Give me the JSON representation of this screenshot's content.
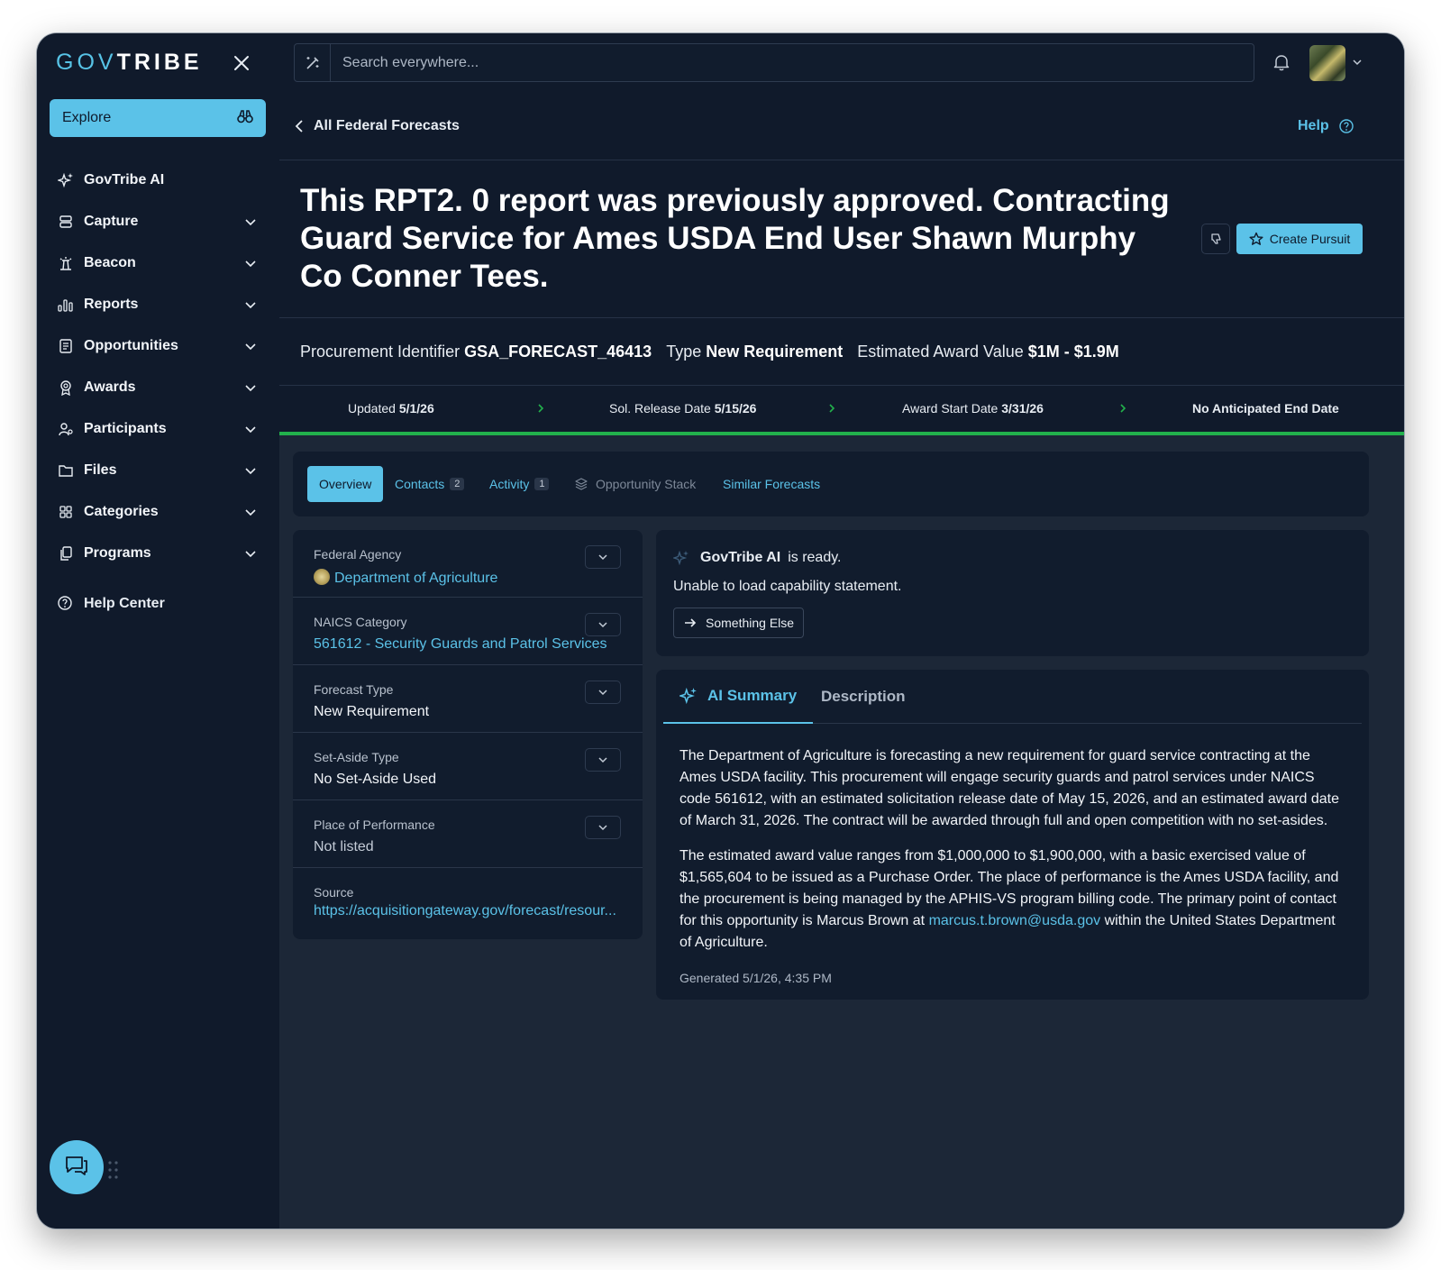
{
  "brand": {
    "gov": "GOV",
    "tribe": "TRIBE"
  },
  "sidebar": {
    "explore_label": "Explore",
    "items": [
      {
        "label": "GovTribe AI",
        "icon": "sparkle-icon",
        "expandable": false
      },
      {
        "label": "Capture",
        "icon": "stack-icon",
        "expandable": true
      },
      {
        "label": "Beacon",
        "icon": "beacon-icon",
        "expandable": true
      },
      {
        "label": "Reports",
        "icon": "bar-chart-icon",
        "expandable": true
      },
      {
        "label": "Opportunities",
        "icon": "document-icon",
        "expandable": true
      },
      {
        "label": "Awards",
        "icon": "award-icon",
        "expandable": true
      },
      {
        "label": "Participants",
        "icon": "people-icon",
        "expandable": true
      },
      {
        "label": "Files",
        "icon": "folder-icon",
        "expandable": true
      },
      {
        "label": "Categories",
        "icon": "grid-icon",
        "expandable": true
      },
      {
        "label": "Programs",
        "icon": "copy-icon",
        "expandable": true
      }
    ],
    "help_center": "Help Center"
  },
  "search": {
    "placeholder": "Search everywhere..."
  },
  "back_link": "All Federal Forecasts",
  "help_link": "Help",
  "page_title": "This RPT2. 0 report was previously approved. Contracting Guard Service for Ames USDA End User Shawn Murphy Co Conner Tees.",
  "create_pursuit": "Create Pursuit",
  "identifiers": {
    "procurement_label": "Procurement Identifier",
    "procurement_value": "GSA_FORECAST_46413",
    "type_label": "Type",
    "type_value": "New Requirement",
    "award_label": "Estimated Award Value",
    "award_value": "$1M - $1.9M"
  },
  "timeline": {
    "updated_label": "Updated",
    "updated_value": "5/1/26",
    "release_label": "Sol. Release Date",
    "release_value": "5/15/26",
    "start_label": "Award Start Date",
    "start_value": "3/31/26",
    "end_text": "No Anticipated End Date"
  },
  "tabs": {
    "overview": "Overview",
    "contacts": "Contacts",
    "contacts_count": "2",
    "activity": "Activity",
    "activity_count": "1",
    "stack": "Opportunity Stack",
    "similar": "Similar Forecasts"
  },
  "details": [
    {
      "label": "Federal Agency",
      "value": "Department of Agriculture"
    },
    {
      "label": "NAICS Category",
      "value": "561612 - Security Guards and Patrol Services"
    },
    {
      "label": "Forecast Type",
      "value": "New Requirement"
    },
    {
      "label": "Set-Aside Type",
      "value": "No Set-Aside Used"
    },
    {
      "label": "Place of Performance",
      "value": "Not listed"
    },
    {
      "label": "Source",
      "value": "https://acquisitiongateway.gov/forecast/resour..."
    }
  ],
  "ai": {
    "name": "GovTribe AI",
    "status": "is ready.",
    "message": "Unable to load capability statement.",
    "button": "Something Else"
  },
  "summary": {
    "tab_ai": "AI Summary",
    "tab_description": "Description",
    "p1": "The Department of Agriculture is forecasting a new requirement for guard service contracting at the Ames USDA facility. This procurement will engage security guards and patrol services under NAICS code 561612, with an estimated solicitation release date of May 15, 2026, and an estimated award date of March 31, 2026. The contract will be awarded through full and open competition with no set-asides.",
    "p2_start": "The estimated award value ranges from $1,000,000 to $1,900,000, with a basic exercised value of $1,565,604 to be issued as a Purchase Order. The place of performance is the Ames USDA facility, and the procurement is being managed by the APHIS-VS program billing code. The primary point of contact for this opportunity is Marcus Brown at",
    "email": "marcus.t.brown@usda.gov",
    "p2_end": "within the United States Department of Agriculture.",
    "generated": "Generated 5/1/26, 4:35 PM"
  },
  "colors": {
    "accent": "#5bc2e8",
    "sidebar_bg": "#101a2b",
    "progress": "#22b14c"
  }
}
